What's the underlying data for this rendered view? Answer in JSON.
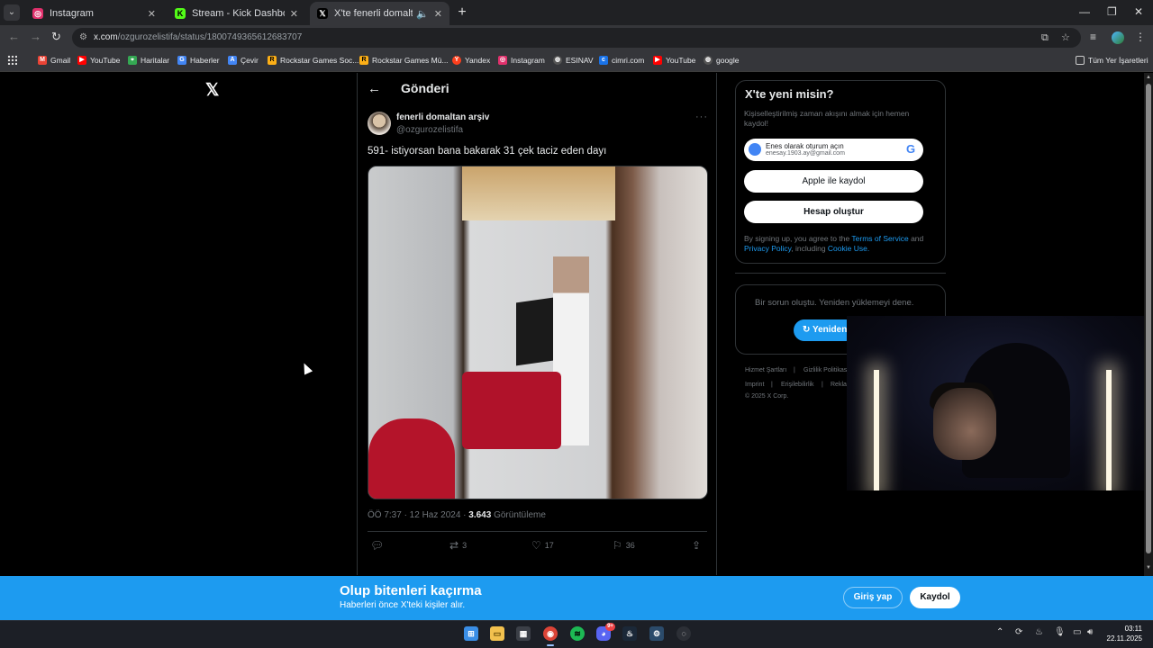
{
  "browser": {
    "tabs": [
      {
        "title": "Instagram",
        "icon": "instagram-icon",
        "color": "#e1306c"
      },
      {
        "title": "Stream - Kick Dashboard",
        "icon": "kick-icon",
        "color": "#53fc18"
      },
      {
        "title": "X'te fenerli domaltan arşiv",
        "icon": "x-icon",
        "color": "#000000"
      }
    ],
    "url_host": "x.com",
    "url_path": "/ozgurozelistifa/status/1800749365612683707",
    "bookmarks": [
      {
        "label": "Gmail",
        "color": "#ea4335"
      },
      {
        "label": "YouTube",
        "color": "#ff0000"
      },
      {
        "label": "Haritalar",
        "color": "#34a853"
      },
      {
        "label": "Haberler",
        "color": "#4285f4"
      },
      {
        "label": "Çevir",
        "color": "#4285f4"
      },
      {
        "label": "Rockstar Games Soc...",
        "color": "#fcaf17"
      },
      {
        "label": "Rockstar Games Mü...",
        "color": "#fcaf17"
      },
      {
        "label": "Yandex",
        "color": "#fc3f1d"
      },
      {
        "label": "Instagram",
        "color": "#e1306c"
      },
      {
        "label": "ESINAV",
        "color": "#555555"
      },
      {
        "label": "cimri.com",
        "color": "#1a73e8"
      },
      {
        "label": "YouTube",
        "color": "#ff0000"
      },
      {
        "label": "google",
        "color": "#555555"
      }
    ],
    "all_bookmarks": "Tüm Yer İşaretleri"
  },
  "post": {
    "header": "Gönderi",
    "author_name": "fenerli domaltan arşiv",
    "author_handle": "@ozgurozelistifa",
    "text": "591- istiyorsan bana bakarak 31 çek taciz eden dayı",
    "time": "ÖÖ 7:37 · 12 Haz 2024 · ",
    "views_count": "3.643",
    "views_label": " Görüntüleme",
    "retweets": "3",
    "likes": "17",
    "bookmarks": "36"
  },
  "signup_card": {
    "title": "X'te yeni misin?",
    "subtitle": "Kişiselleştirilmiş zaman akışını almak için hemen kaydol!",
    "google_line1": "Enes olarak oturum açın",
    "google_line2": "enesay.1903.ay@gmail.com",
    "apple_label": "Apple ile kaydol",
    "create_label": "Hesap oluştur",
    "terms_prefix": "By signing up, you agree to the ",
    "terms_link": "Terms of Service",
    "terms_and": " and ",
    "privacy_link": "Privacy Policy",
    "terms_including": ", including ",
    "cookie_link": "Cookie Use."
  },
  "error_card": {
    "message": "Bir sorun oluştu. Yeniden yüklemeyi dene.",
    "retry_label": "Yeniden dene"
  },
  "footer": {
    "links_row1": [
      "Hizmet Şartları",
      "Gizlilik Politikası"
    ],
    "links_row2": [
      "Imprint",
      "Erişilebilirlik",
      "Reklam bilgisi"
    ],
    "copyright": "© 2025 X Corp."
  },
  "banner": {
    "title": "Olup bitenleri kaçırma",
    "subtitle": "Haberleri önce X'teki kişiler alır.",
    "login_label": "Giriş yap",
    "signup_label": "Kaydol"
  },
  "taskbar": {
    "time": "03:11",
    "date": "22.11.2025",
    "discord_badge": "9+"
  }
}
